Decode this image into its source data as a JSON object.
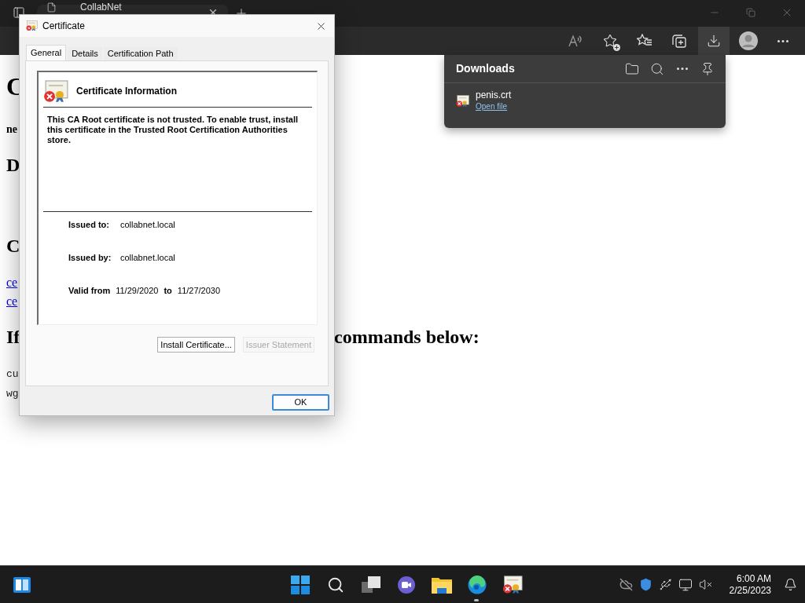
{
  "browser": {
    "tab": {
      "title": "CollabNet"
    },
    "toolbar": [
      {
        "kind": "read_aloud",
        "active": false
      },
      {
        "kind": "add_favorite",
        "active": false
      },
      {
        "kind": "favorites",
        "active": false
      },
      {
        "kind": "collections",
        "active": false
      },
      {
        "kind": "downloads",
        "active": true
      },
      {
        "kind": "profile",
        "active": false
      },
      {
        "kind": "more",
        "active": false
      }
    ],
    "downloads": {
      "title": "Downloads",
      "items": [
        {
          "file": "penis.crt",
          "action": "Open file"
        }
      ]
    }
  },
  "page": {
    "fragments": [
      {
        "kind": "h1",
        "text": "C"
      },
      {
        "kind": "strong",
        "text": "ne"
      },
      {
        "kind": "h2",
        "text": "D"
      },
      {
        "kind": "h2",
        "text": "C"
      },
      {
        "kind": "link",
        "text": "ce"
      },
      {
        "kind": "link",
        "text": "ce"
      },
      {
        "kind": "h2",
        "text": "If",
        "tail": "commands below:"
      },
      {
        "kind": "code",
        "text": "cu"
      },
      {
        "kind": "code",
        "text": "wg"
      }
    ]
  },
  "dialog": {
    "title": "Certificate",
    "tabs": [
      {
        "label": "General",
        "selected": true
      },
      {
        "label": "Details",
        "selected": false
      },
      {
        "label": "Certification Path",
        "selected": false
      }
    ],
    "heading": "Certificate Information",
    "message": "This CA Root certificate is not trusted. To enable trust, install this certificate in the Trusted Root Certification Authorities store.",
    "fields": [
      {
        "label": "Issued to:",
        "value": "collabnet.local"
      },
      {
        "label": "Issued by:",
        "value": "collabnet.local"
      }
    ],
    "validity": {
      "label": "Valid from",
      "from": "11/29/2020",
      "to_label": "to",
      "to": "11/27/2030"
    },
    "buttons": [
      {
        "label": "Install Certificate...",
        "disabled": false
      },
      {
        "label": "Issuer Statement",
        "disabled": true
      }
    ],
    "ok": "OK"
  },
  "taskbar": {
    "apps": [
      {
        "kind": "start",
        "running": false
      },
      {
        "kind": "search",
        "running": false
      },
      {
        "kind": "task_view",
        "running": false
      },
      {
        "kind": "chat",
        "running": false
      },
      {
        "kind": "explorer",
        "running": false
      },
      {
        "kind": "edge",
        "running": true
      },
      {
        "kind": "certificate",
        "running": false
      }
    ],
    "clock": {
      "time": "6:00 AM",
      "date": "2/25/2023"
    }
  }
}
